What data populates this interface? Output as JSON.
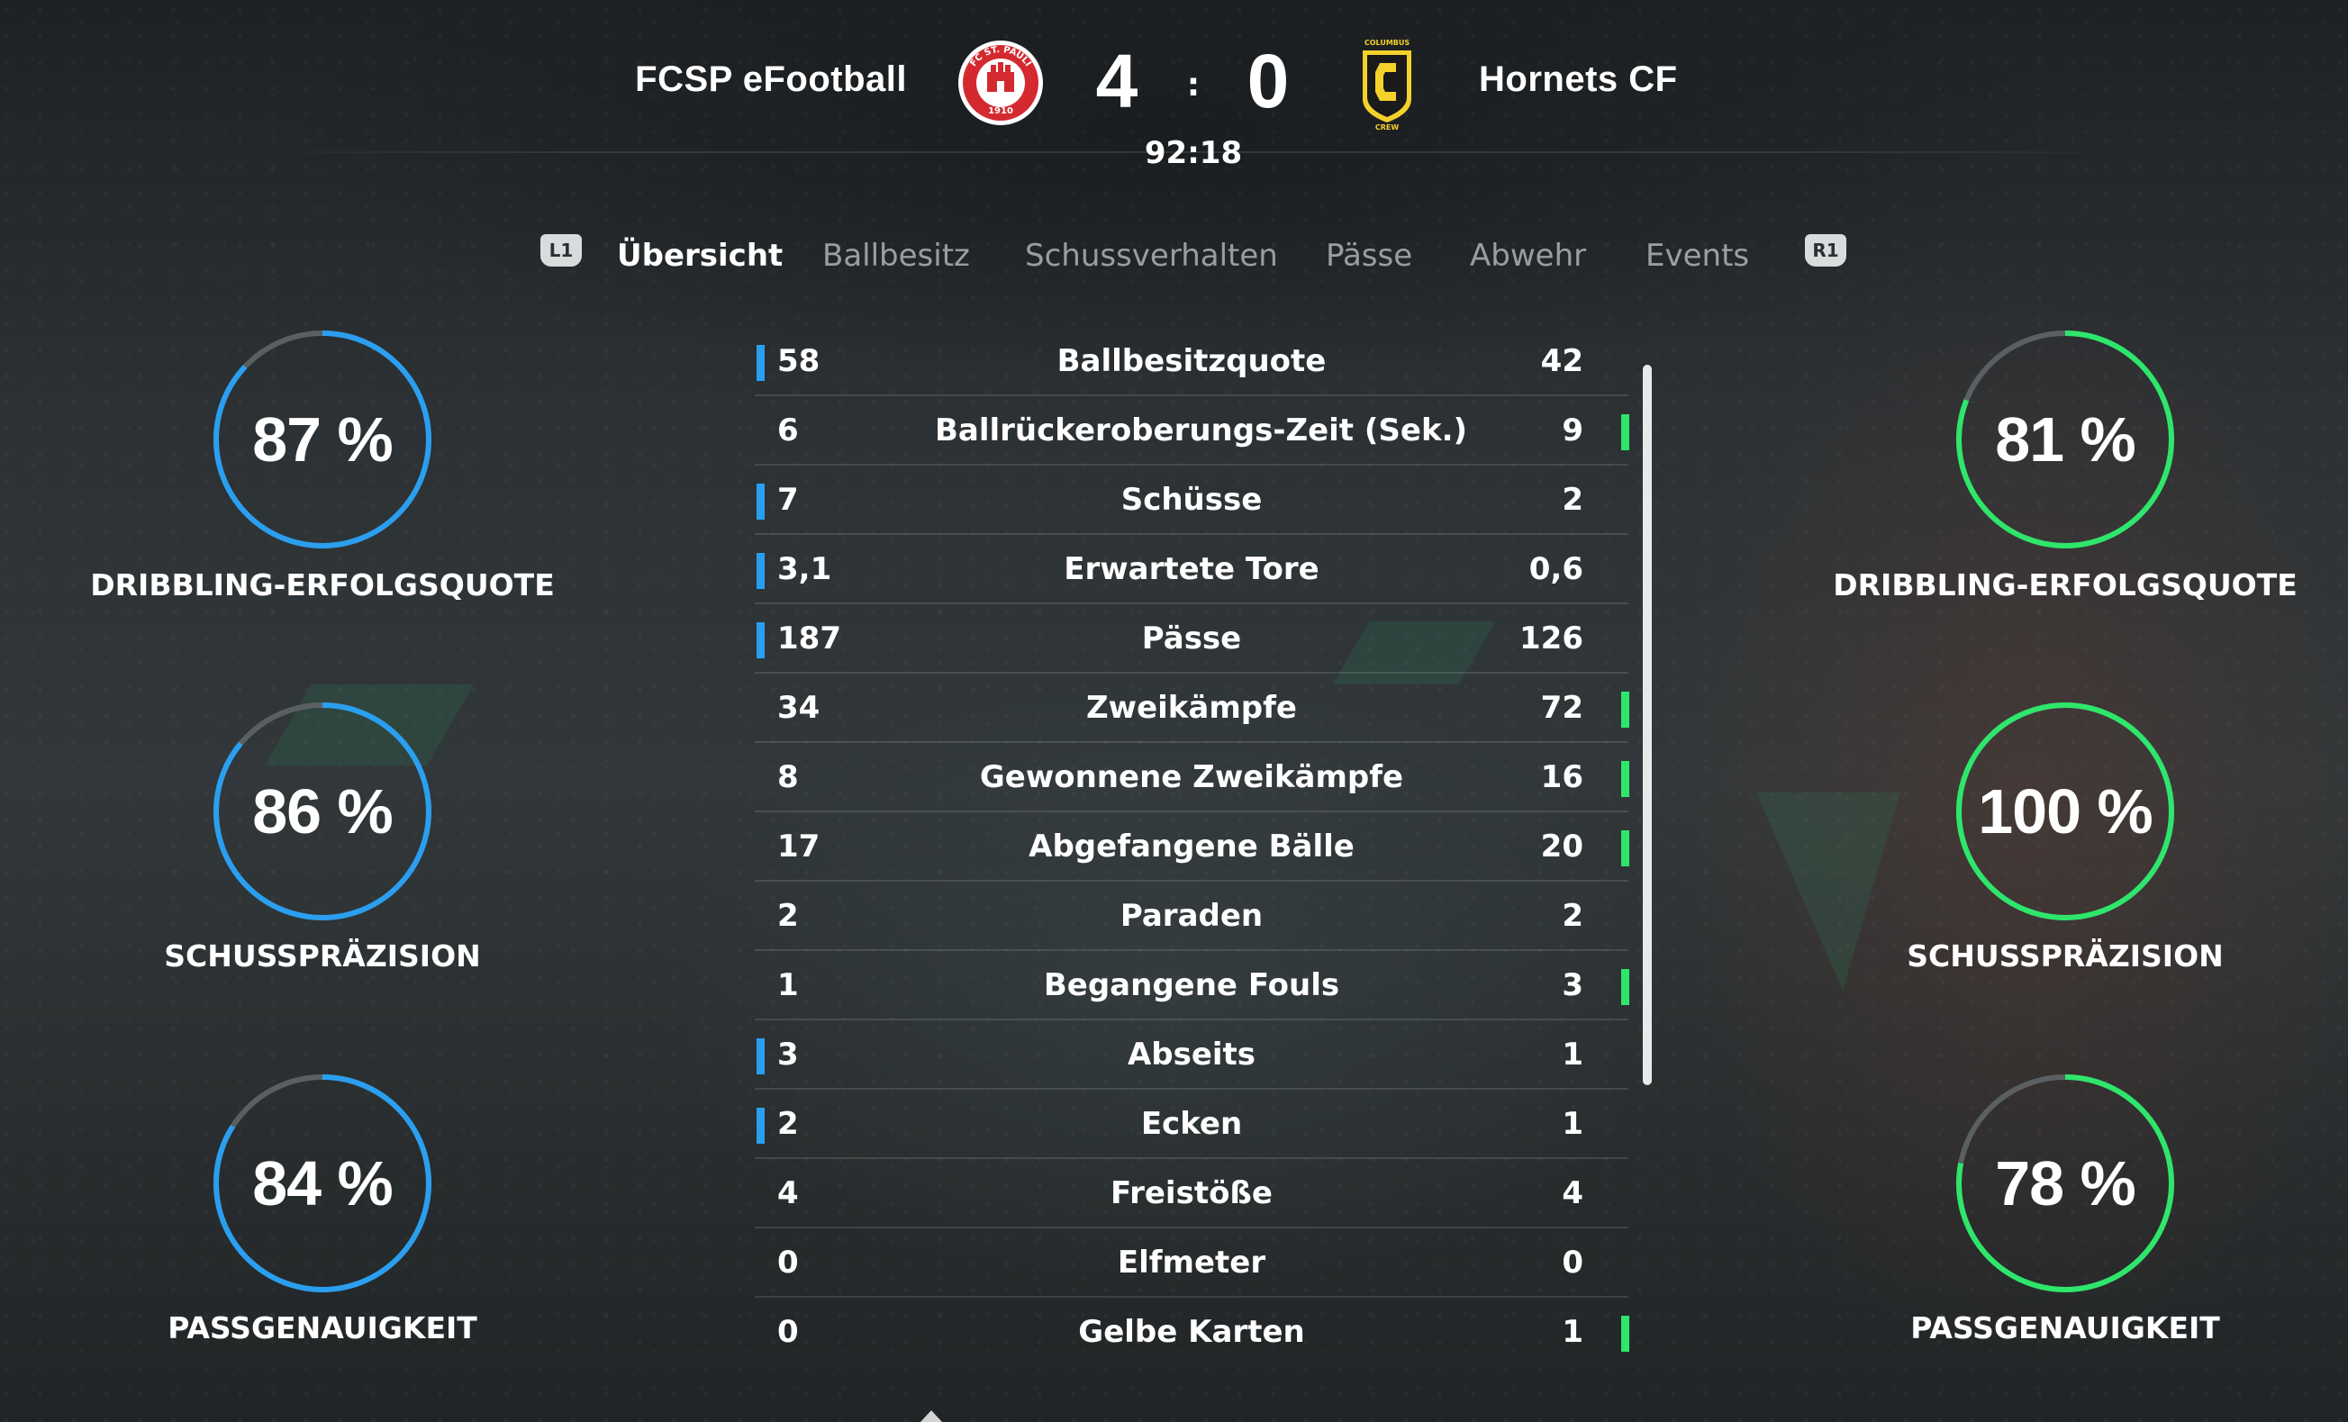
{
  "header": {
    "home_team": "FCSP eFootball",
    "away_team": "Hornets CF",
    "home_score": "4",
    "away_score": "0",
    "separator": ":",
    "clock": "92:18",
    "home_crest": {
      "icon": "fc-st-pauli-crest-icon",
      "text_top": "FC ST. PAULI",
      "text_bottom": "1910"
    },
    "away_crest": {
      "icon": "columbus-crew-crest-icon",
      "text_top": "COLUMBUS",
      "text_bottom": "CREW"
    }
  },
  "tabs": {
    "left_bumper": "L1",
    "right_bumper": "R1",
    "items": [
      {
        "label": "Übersicht",
        "active": true
      },
      {
        "label": "Ballbesitz",
        "active": false
      },
      {
        "label": "Schussverhalten",
        "active": false
      },
      {
        "label": "Pässe",
        "active": false
      },
      {
        "label": "Abwehr",
        "active": false
      },
      {
        "label": "Events",
        "active": false
      }
    ]
  },
  "gauges": {
    "home": [
      {
        "value": "87 %",
        "percent": 87,
        "label": "DRIBBLING-ERFOLGSQUOTE"
      },
      {
        "value": "86 %",
        "percent": 86,
        "label": "SCHUSSPRÄZISION"
      },
      {
        "value": "84 %",
        "percent": 84,
        "label": "PASSGENAUIGKEIT"
      }
    ],
    "away": [
      {
        "value": "81 %",
        "percent": 81,
        "label": "DRIBBLING-ERFOLGSQUOTE"
      },
      {
        "value": "100 %",
        "percent": 100,
        "label": "SCHUSSPRÄZISION"
      },
      {
        "value": "78 %",
        "percent": 78,
        "label": "PASSGENAUIGKEIT"
      }
    ]
  },
  "stats": [
    {
      "home": "58",
      "label": "Ballbesitzquote",
      "away": "42",
      "lead": "home"
    },
    {
      "home": "6",
      "label": "Ballrückeroberungs-Zeit (Sek.)",
      "away": "9",
      "lead": "away"
    },
    {
      "home": "7",
      "label": "Schüsse",
      "away": "2",
      "lead": "home"
    },
    {
      "home": "3,1",
      "label": "Erwartete Tore",
      "away": "0,6",
      "lead": "home"
    },
    {
      "home": "187",
      "label": "Pässe",
      "away": "126",
      "lead": "home"
    },
    {
      "home": "34",
      "label": "Zweikämpfe",
      "away": "72",
      "lead": "away"
    },
    {
      "home": "8",
      "label": "Gewonnene Zweikämpfe",
      "away": "16",
      "lead": "away"
    },
    {
      "home": "17",
      "label": "Abgefangene Bälle",
      "away": "20",
      "lead": "away"
    },
    {
      "home": "2",
      "label": "Paraden",
      "away": "2",
      "lead": "none"
    },
    {
      "home": "1",
      "label": "Begangene Fouls",
      "away": "3",
      "lead": "away"
    },
    {
      "home": "3",
      "label": "Abseits",
      "away": "1",
      "lead": "home"
    },
    {
      "home": "2",
      "label": "Ecken",
      "away": "1",
      "lead": "home"
    },
    {
      "home": "4",
      "label": "Freistöße",
      "away": "4",
      "lead": "none"
    },
    {
      "home": "0",
      "label": "Elfmeter",
      "away": "0",
      "lead": "none"
    },
    {
      "home": "0",
      "label": "Gelbe Karten",
      "away": "1",
      "lead": "away"
    }
  ],
  "colors": {
    "home_accent": "#2a9ff0",
    "away_accent": "#2ee66b",
    "track": "#5a6062"
  }
}
